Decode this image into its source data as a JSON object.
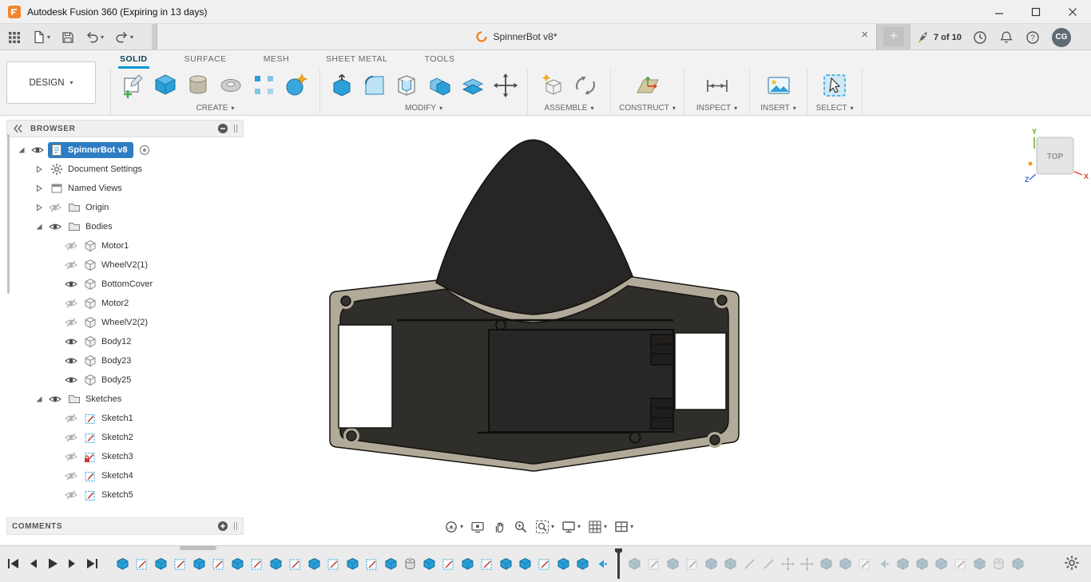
{
  "colors": {
    "accent": "#0696d7",
    "selection": "#2e7cc3",
    "model_dark": "#302e2b",
    "model_tan": "#b1aa99"
  },
  "titlebar": {
    "title": "Autodesk Fusion 360 (Expiring in 13 days)",
    "window_buttons": [
      "minimize",
      "maximize",
      "close"
    ]
  },
  "quick_access": {
    "icons": [
      "app-launcher",
      "file-menu",
      "save",
      "undo",
      "redo"
    ]
  },
  "doc_tabs": {
    "active_tab": "SpinnerBot v8*",
    "close_glyph": "×",
    "new_tab_glyph": "+"
  },
  "status": {
    "jobs": "7 of 10",
    "icons": [
      "job-status",
      "recent-clock",
      "notifications-bell",
      "help"
    ],
    "avatar": "CG"
  },
  "ribbon": {
    "workspace": "DESIGN",
    "tabs": [
      "SOLID",
      "SURFACE",
      "MESH",
      "SHEET METAL",
      "TOOLS"
    ],
    "active_tab": "SOLID",
    "groups": [
      {
        "label": "CREATE",
        "icons": [
          "create-sketch",
          "box-primitive",
          "cylinder-primitive",
          "torus-primitive",
          "pattern",
          "create-form"
        ]
      },
      {
        "label": "MODIFY",
        "icons": [
          "press-pull",
          "fillet",
          "shell",
          "combine",
          "offset-face",
          "move-copy"
        ]
      },
      {
        "label": "ASSEMBLE",
        "icons": [
          "new-component",
          "joint"
        ]
      },
      {
        "label": "CONSTRUCT",
        "icons": [
          "construction-plane"
        ]
      },
      {
        "label": "INSPECT",
        "icons": [
          "measure"
        ]
      },
      {
        "label": "INSERT",
        "icons": [
          "insert-canvas"
        ]
      },
      {
        "label": "SELECT",
        "icons": [
          "select-cursor"
        ]
      }
    ]
  },
  "browser": {
    "header": "BROWSER",
    "comments": "COMMENTS",
    "rows": [
      {
        "label": "SpinnerBot v8",
        "level": 0,
        "icon": "document",
        "eye": "visible",
        "expander": "expanded",
        "selected": true,
        "target": true
      },
      {
        "label": "Document Settings",
        "level": 1,
        "icon": "gear",
        "expander": "collapsed"
      },
      {
        "label": "Named Views",
        "level": 1,
        "icon": "views",
        "expander": "collapsed"
      },
      {
        "label": "Origin",
        "level": 1,
        "icon": "folder",
        "eye": "hidden",
        "expander": "collapsed"
      },
      {
        "label": "Bodies",
        "level": 1,
        "icon": "folder",
        "eye": "visible",
        "expander": "expanded"
      },
      {
        "label": "Motor1",
        "level": 2,
        "icon": "body",
        "eye": "hidden"
      },
      {
        "label": "WheelV2(1)",
        "level": 2,
        "icon": "body",
        "eye": "hidden"
      },
      {
        "label": "BottomCover",
        "level": 2,
        "icon": "body",
        "eye": "visible"
      },
      {
        "label": "Motor2",
        "level": 2,
        "icon": "body",
        "eye": "hidden"
      },
      {
        "label": "WheelV2(2)",
        "level": 2,
        "icon": "body",
        "eye": "hidden"
      },
      {
        "label": "Body12",
        "level": 2,
        "icon": "body",
        "eye": "visible"
      },
      {
        "label": "Body23",
        "level": 2,
        "icon": "body",
        "eye": "visible"
      },
      {
        "label": "Body25",
        "level": 2,
        "icon": "body",
        "eye": "visible"
      },
      {
        "label": "Sketches",
        "level": 1,
        "icon": "folder",
        "eye": "visible",
        "expander": "expanded"
      },
      {
        "label": "Sketch1",
        "level": 2,
        "icon": "sketch",
        "eye": "hidden"
      },
      {
        "label": "Sketch2",
        "level": 2,
        "icon": "sketch",
        "eye": "hidden"
      },
      {
        "label": "Sketch3",
        "level": 2,
        "icon": "sketch",
        "eye": "hidden",
        "locked": true
      },
      {
        "label": "Sketch4",
        "level": 2,
        "icon": "sketch",
        "eye": "hidden"
      },
      {
        "label": "Sketch5",
        "level": 2,
        "icon": "sketch",
        "eye": "hidden"
      }
    ]
  },
  "viewcube": {
    "face": "TOP",
    "axes": {
      "x": "X",
      "y": "Y",
      "z": "Z"
    }
  },
  "navbar": {
    "items": [
      {
        "name": "orbit",
        "caret": true
      },
      {
        "name": "look-at",
        "caret": false
      },
      {
        "name": "pan",
        "caret": false
      },
      {
        "name": "zoom",
        "caret": false
      },
      {
        "name": "fit",
        "caret": true
      },
      {
        "name": "display-settings",
        "caret": true
      },
      {
        "name": "grid-snaps",
        "caret": true
      },
      {
        "name": "viewports",
        "caret": true
      }
    ]
  },
  "timeline": {
    "playback": [
      "go-to-start",
      "step-back",
      "play",
      "step-forward",
      "go-to-end"
    ],
    "features": [
      "extrude",
      "sketch",
      "extrude",
      "sketch",
      "extrude",
      "sketch",
      "extrude",
      "sketch",
      "extrude",
      "sketch",
      "extrude",
      "sketch",
      "extrude",
      "sketch",
      "extrude",
      "hole",
      "extrude",
      "sketch",
      "extrude",
      "sketch",
      "extrude",
      "extrude",
      "sketch",
      "extrude",
      "extrude",
      "arrow"
    ],
    "marker": "position-marker",
    "rolled_features": [
      "extrude",
      "sketch",
      "extrude",
      "sketch",
      "extrude",
      "extrude",
      "line",
      "line",
      "move",
      "move",
      "extrude",
      "extrude",
      "sketch",
      "arrow",
      "extrude",
      "extrude",
      "extrude",
      "sketch",
      "extrude",
      "hole",
      "extrude"
    ],
    "settings": "timeline-settings-gear"
  }
}
